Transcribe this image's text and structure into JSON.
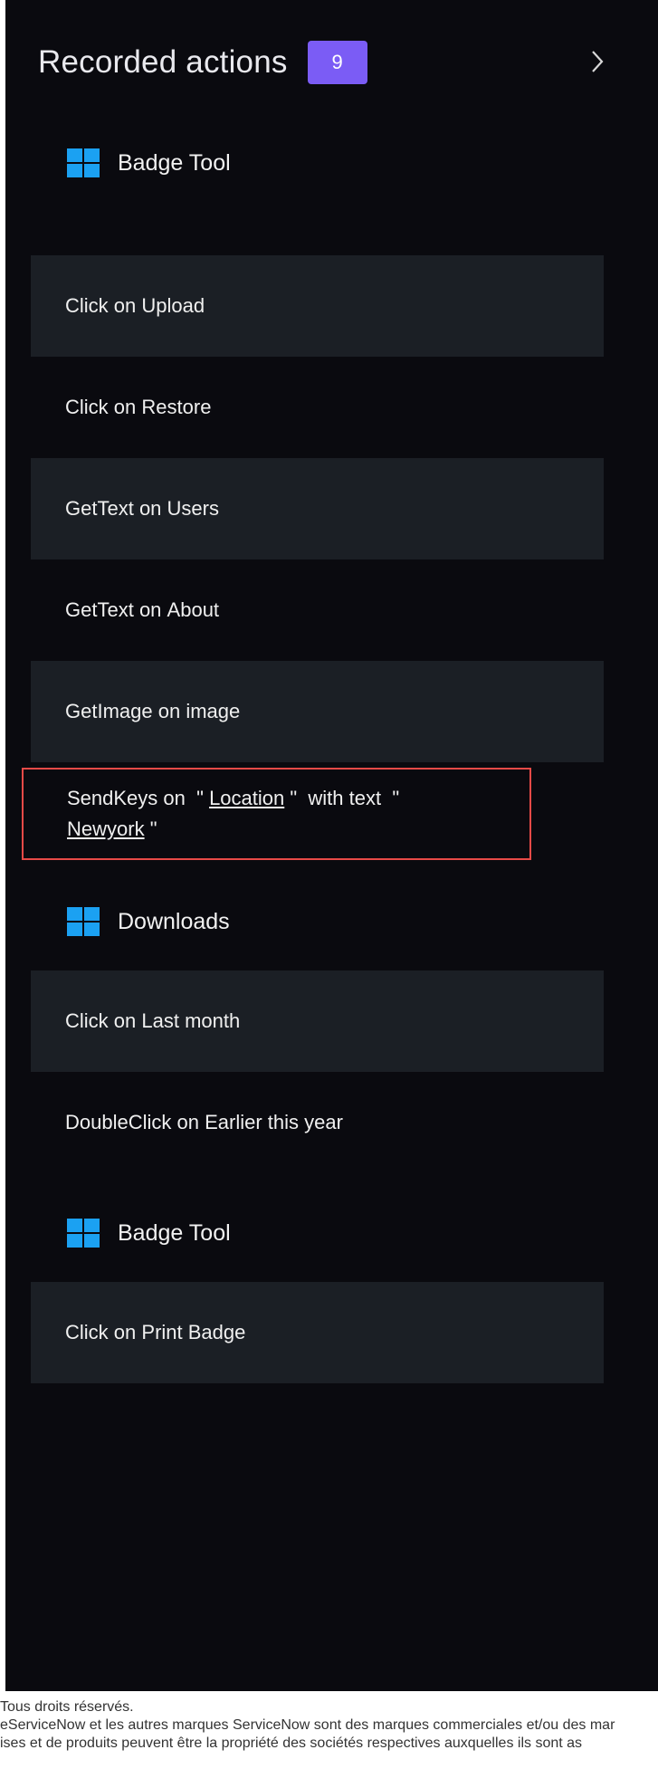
{
  "header": {
    "title": "Recorded actions",
    "count": "9",
    "chevron_icon": "chevron-right-icon",
    "accent": "#7b5cf5"
  },
  "groups": [
    {
      "label": "Badge Tool",
      "icon": "windows-logo-icon",
      "actions": [
        {
          "verb": "Click",
          "target": "Upload"
        },
        {
          "verb": "Click",
          "target": "Restore"
        },
        {
          "verb": "GetText",
          "target": "Users"
        },
        {
          "verb": "GetText",
          "target": "About"
        },
        {
          "verb": "GetImage",
          "target": "image"
        }
      ]
    },
    {
      "label": "Downloads",
      "icon": "windows-logo-icon",
      "actions": [
        {
          "verb": "Click",
          "target": "Last month"
        },
        {
          "verb": "DoubleClick",
          "target": "Earlier this year"
        }
      ]
    },
    {
      "label": "Badge Tool",
      "icon": "windows-logo-icon",
      "actions": [
        {
          "verb": "Click",
          "target": "Print Badge"
        }
      ]
    }
  ],
  "highlighted_action": {
    "verb": "SendKeys",
    "on": "on",
    "field": "Location",
    "with_text": "with text",
    "value": "Newyork",
    "border_color": "#e84a47"
  },
  "on_word": "on",
  "footer": {
    "line1": "Tous droits réservés.",
    "line2": "eServiceNow et les autres marques ServiceNow sont des marques commerciales et/ou des mar",
    "line3": "ises et de produits peuvent être la propriété des sociétés respectives auxquelles ils sont as"
  }
}
